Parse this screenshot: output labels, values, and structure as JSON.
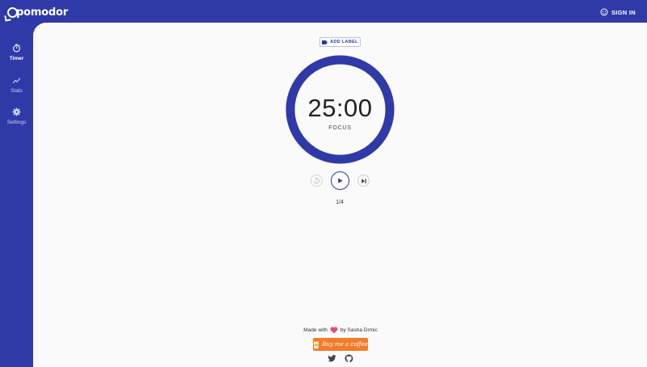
{
  "app": {
    "logo_text": "pomodor"
  },
  "header": {
    "signin_label": "SIGN IN"
  },
  "sidebar": {
    "items": [
      {
        "label": "Timer",
        "icon": "stopwatch-icon"
      },
      {
        "label": "Stats",
        "icon": "trending-line-icon"
      },
      {
        "label": "Settings",
        "icon": "gear-icon"
      }
    ]
  },
  "timer": {
    "add_label": "ADD LABEL",
    "time": "25:00",
    "mode": "FOCUS",
    "round": "1/4",
    "progress": 1.0
  },
  "controls": {
    "reset_icon": "reset-icon",
    "play_icon": "play-icon",
    "skip_icon": "skip-next-icon"
  },
  "footer": {
    "made_with": "Made with",
    "by_author": "by Sasha Drmic",
    "coffee_label": "Buy me a coffee"
  },
  "colors": {
    "primary": "#2f3aa8",
    "background": "#fafafa",
    "heart": "#e94b78",
    "coffee": "#f47b2a"
  }
}
